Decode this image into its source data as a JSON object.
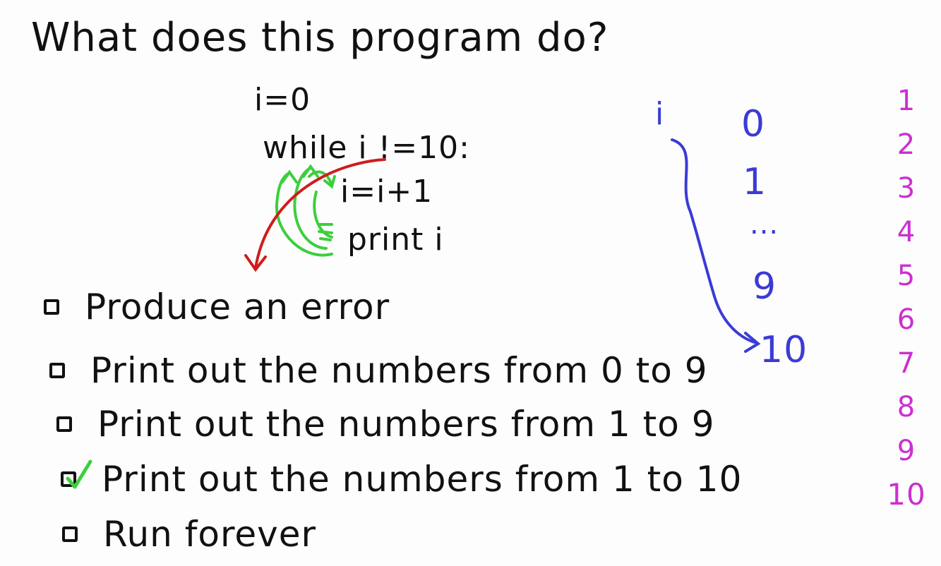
{
  "question": {
    "title": "What does this program do?"
  },
  "code": {
    "line1": "i=0",
    "line2": "while i !=10:",
    "line3": "i=i+1",
    "line4": "print i"
  },
  "options": [
    {
      "label": "Produce an error",
      "checked": false
    },
    {
      "label": "Print out the numbers from 0 to 9",
      "checked": false
    },
    {
      "label": "Print out the numbers from 1 to 9",
      "checked": false
    },
    {
      "label": "Print out the numbers from 1 to 10",
      "checked": true
    },
    {
      "label": "Run forever",
      "checked": false
    }
  ],
  "trace": {
    "variable": "i",
    "values": [
      "0",
      "1",
      "...",
      "9",
      "10"
    ]
  },
  "output": {
    "numbers": [
      "1",
      "2",
      "3",
      "4",
      "5",
      "6",
      "7",
      "8",
      "9",
      "10"
    ]
  },
  "colors": {
    "ink": "#111111",
    "loop_arrows": "#3ccf3c",
    "exit_arrow": "#d01c1c",
    "trace": "#3b3bd6",
    "output": "#cc2fd0",
    "check": "#3ccf3c"
  }
}
